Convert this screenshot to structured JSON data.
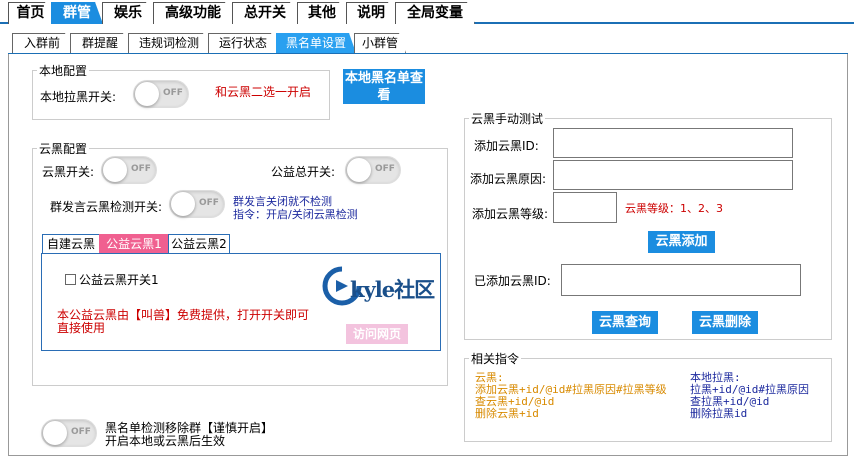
{
  "top_tabs": [
    "首页",
    "群管",
    "娱乐",
    "高级功能",
    "总开关",
    "其他",
    "说明",
    "全局变量"
  ],
  "sub_tabs": [
    "入群前",
    "群提醒",
    "违规词检测",
    "运行状态",
    "黑名单设置",
    "小群管"
  ],
  "toggle_off_text": "OFF",
  "local": {
    "legend": "本地配置",
    "pull_label": "本地拉黑开关:",
    "note": "和云黑二选一开启",
    "view_button": "本地黑名单查看"
  },
  "cloud": {
    "legend": "云黑配置",
    "switch_label": "云黑开关:",
    "public_total_label": "公益总开关:",
    "speak_detect_label": "群发言云黑检测开关:",
    "speak_note_1": "群发言关闭就不检测",
    "speak_note_2": "指令：开启/关闭云黑检测",
    "inner_tabs": [
      "自建云黑",
      "公益云黑1",
      "公益云黑2"
    ],
    "public1_checkbox": "公益云黑开关1",
    "public1_desc": "本公益云黑由【叫兽】免费提供，打开开关即可直接使用",
    "logo_text": "kyle社区",
    "visit_button": "访问网页"
  },
  "manual": {
    "legend": "云黑手动测试",
    "id_label": "添加云黑ID:",
    "reason_label": "添加云黑原因:",
    "level_label": "添加云黑等级:",
    "level_hint": "云黑等级：1、2、3",
    "add_button": "云黑添加",
    "added_label": "已添加云黑ID:",
    "query_button": "云黑查询",
    "delete_button": "云黑删除"
  },
  "commands": {
    "legend": "相关指令",
    "cloud_lines": [
      "云黑:",
      "添加云黑+id/@id#拉黑原因#拉黑等级",
      "查云黑+id/@id",
      "删除云黑+id"
    ],
    "local_lines": [
      "本地拉黑:",
      "拉黑+id/@id#拉黑原因",
      "查拉黑+id/@id",
      "删除拉黑id"
    ]
  },
  "remove": {
    "line1": "黑名单检测移除群【谨慎开启】",
    "line2": "开启本地或云黑后生效"
  },
  "colors": {
    "accent": "#1b8de0",
    "pink": "#f06090",
    "red": "#cc0000",
    "navy": "#1d2a9e",
    "orange": "#d88a00"
  }
}
